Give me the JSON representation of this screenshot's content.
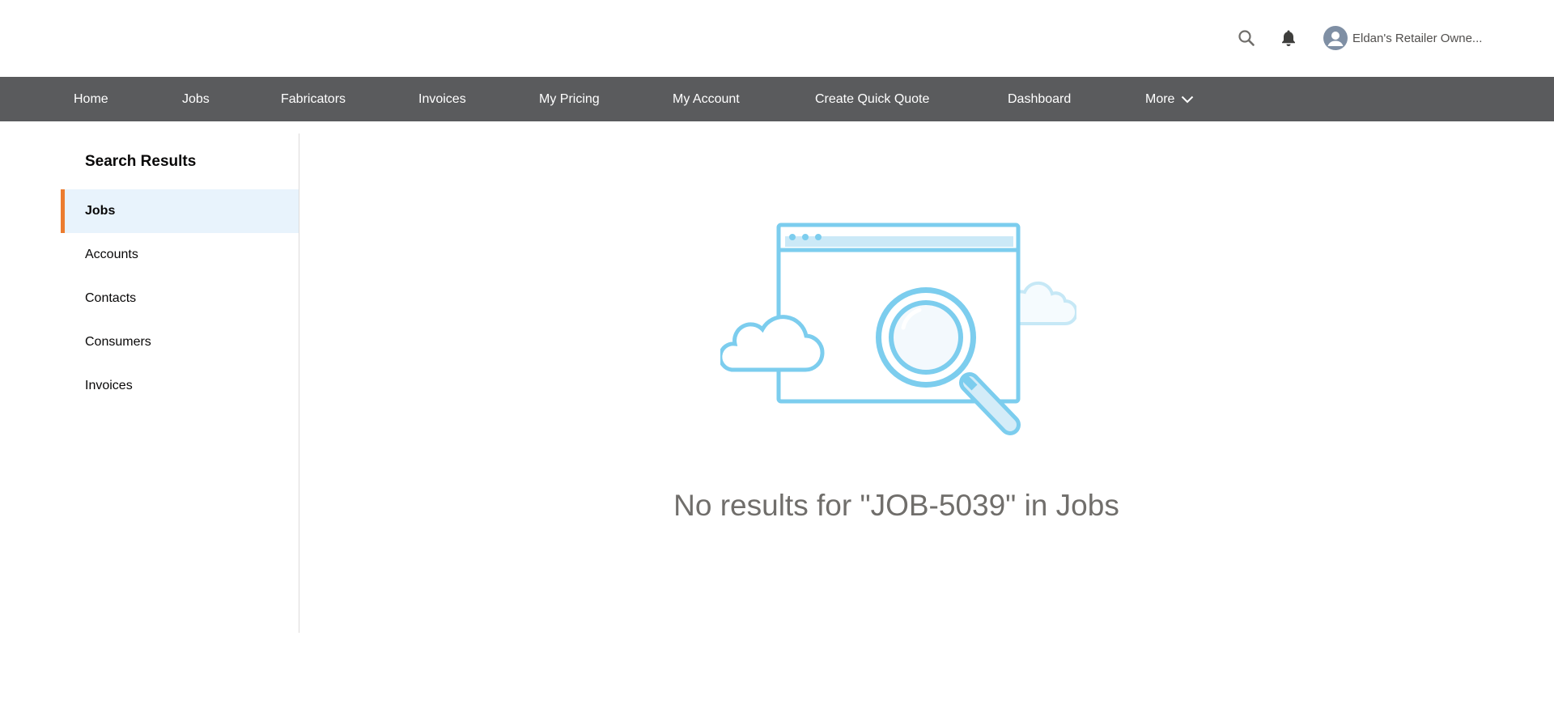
{
  "header": {
    "user_name": "Eldan's Retailer Owne...",
    "icons": [
      "search-icon",
      "bell-icon",
      "user-avatar-icon"
    ]
  },
  "nav": {
    "items": [
      {
        "label": "Home"
      },
      {
        "label": "Jobs"
      },
      {
        "label": "Fabricators"
      },
      {
        "label": "Invoices"
      },
      {
        "label": "My Pricing"
      },
      {
        "label": "My Account"
      },
      {
        "label": "Create Quick Quote"
      },
      {
        "label": "Dashboard"
      }
    ],
    "more_label": "More"
  },
  "sidebar": {
    "title": "Search Results",
    "items": [
      {
        "label": "Jobs",
        "active": true
      },
      {
        "label": "Accounts",
        "active": false
      },
      {
        "label": "Contacts",
        "active": false
      },
      {
        "label": "Consumers",
        "active": false
      },
      {
        "label": "Invoices",
        "active": false
      }
    ]
  },
  "main": {
    "empty_message": "No results for \"JOB-5039\" in Jobs"
  },
  "colors": {
    "nav_bg": "#5a5b5d",
    "active_item_bg": "#e8f3fc",
    "active_indicator": "#ec7c2f",
    "illustration_blue": "#7ccdee"
  }
}
